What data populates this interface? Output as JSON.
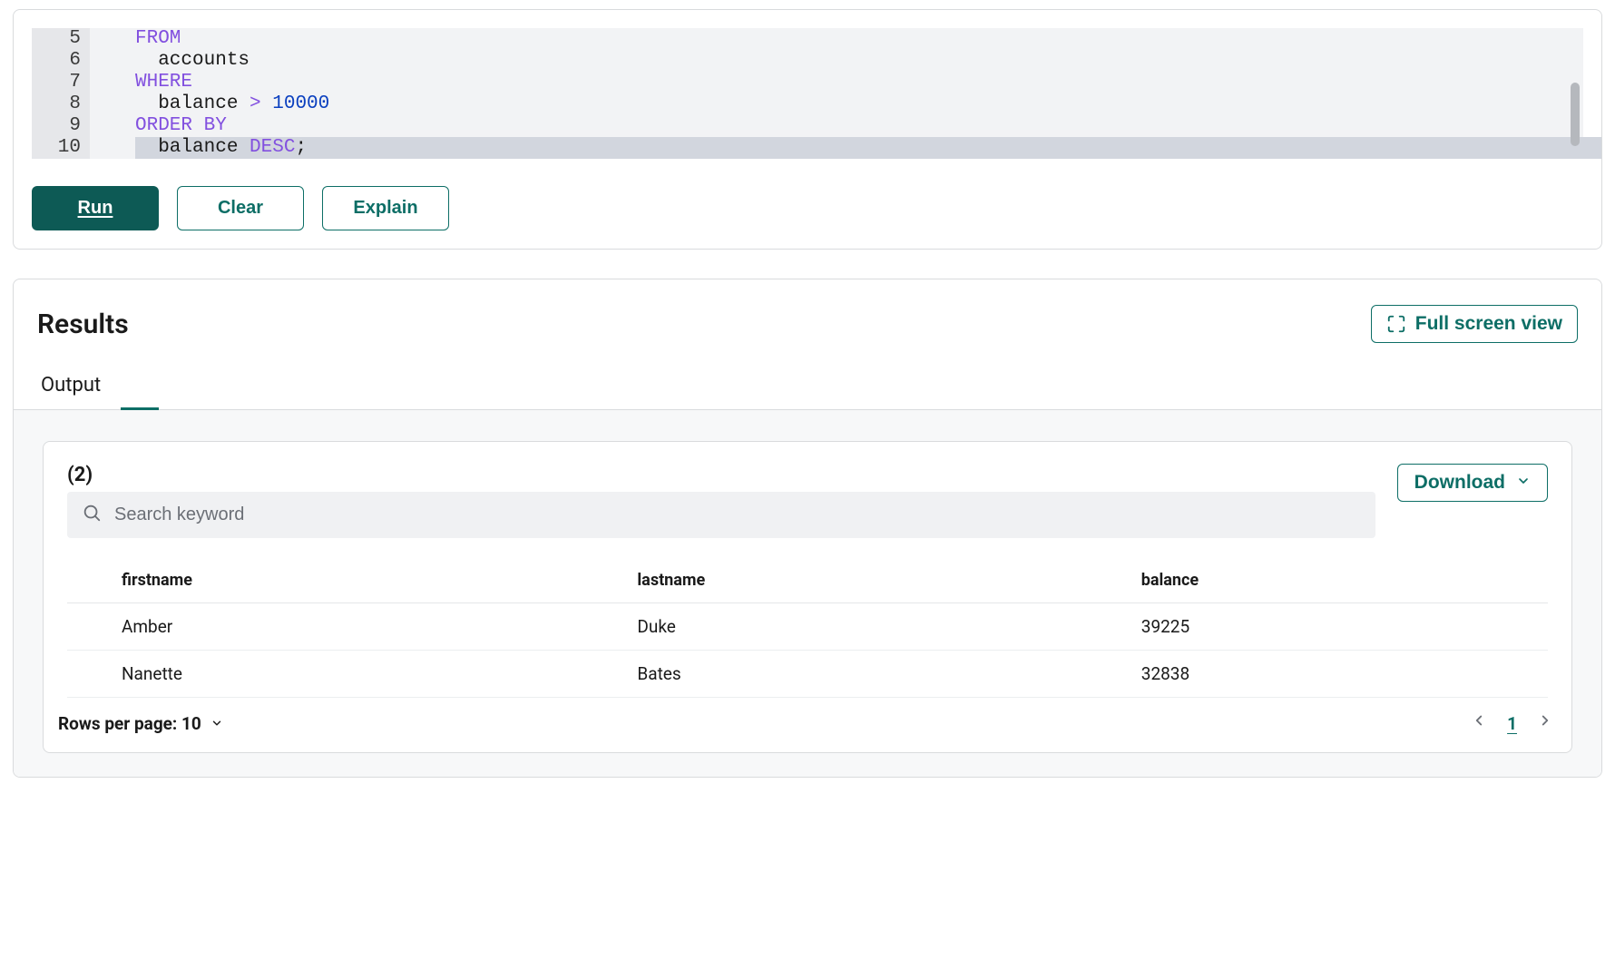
{
  "editor": {
    "lines": [
      {
        "num": 5,
        "tokens": [
          {
            "t": "FROM",
            "c": "kw"
          }
        ]
      },
      {
        "num": 6,
        "tokens": [
          {
            "t": "  accounts",
            "c": "ident"
          }
        ]
      },
      {
        "num": 7,
        "tokens": [
          {
            "t": "WHERE",
            "c": "kw"
          }
        ]
      },
      {
        "num": 8,
        "tokens": [
          {
            "t": "  balance ",
            "c": "ident"
          },
          {
            "t": ">",
            "c": "op"
          },
          {
            "t": " ",
            "c": "ident"
          },
          {
            "t": "10000",
            "c": "num"
          }
        ]
      },
      {
        "num": 9,
        "tokens": [
          {
            "t": "ORDER BY",
            "c": "kw"
          }
        ]
      },
      {
        "num": 10,
        "tokens": [
          {
            "t": "  balance ",
            "c": "ident"
          },
          {
            "t": "DESC",
            "c": "kw"
          },
          {
            "t": ";",
            "c": "ident"
          }
        ],
        "hl": true
      }
    ],
    "buttons": {
      "run": "Run",
      "clear": "Clear",
      "explain": "Explain"
    }
  },
  "results": {
    "title": "Results",
    "fullscreen_label": "Full screen view",
    "tab_output": "Output",
    "count_label": "(2)",
    "search_placeholder": "Search keyword",
    "download_label": "Download",
    "columns": [
      "firstname",
      "lastname",
      "balance"
    ],
    "rows": [
      {
        "firstname": "Amber",
        "lastname": "Duke",
        "balance": "39225"
      },
      {
        "firstname": "Nanette",
        "lastname": "Bates",
        "balance": "32838"
      }
    ],
    "rows_per_page_label": "Rows per page: 10",
    "current_page": "1"
  }
}
